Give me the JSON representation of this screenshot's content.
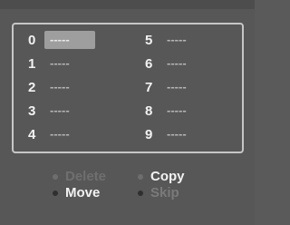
{
  "slots": [
    {
      "num": "0",
      "value": "-----",
      "selected": true
    },
    {
      "num": "1",
      "value": "-----"
    },
    {
      "num": "2",
      "value": "-----"
    },
    {
      "num": "3",
      "value": "-----"
    },
    {
      "num": "4",
      "value": "-----"
    },
    {
      "num": "5",
      "value": "-----"
    },
    {
      "num": "6",
      "value": "-----"
    },
    {
      "num": "7",
      "value": "-----"
    },
    {
      "num": "8",
      "value": "-----"
    },
    {
      "num": "9",
      "value": "-----"
    }
  ],
  "actions": {
    "delete": {
      "label": "Delete",
      "state": "dim"
    },
    "copy": {
      "label": "Copy",
      "state": "lit"
    },
    "move": {
      "label": "Move",
      "state": "lit"
    },
    "skip": {
      "label": "Skip",
      "state": "off"
    }
  },
  "colors": {
    "background": "#575757",
    "panel_border": "#c6c6c6",
    "selected_slot": "#9e9e9e",
    "active_text": "#f2f2f2",
    "dim_text": "#6f6f6f"
  }
}
